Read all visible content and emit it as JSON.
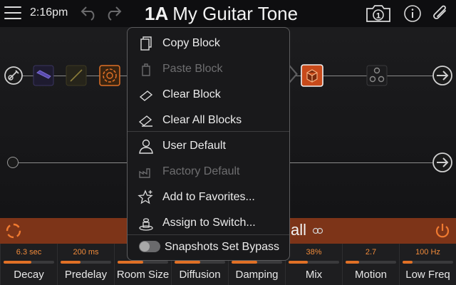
{
  "header": {
    "time": "2:16pm",
    "preset_number": "1A",
    "preset_name": "My Guitar Tone",
    "snapshot_number": "1"
  },
  "signal_flow": {
    "blocks": [
      {
        "name": "input-icon"
      },
      {
        "name": "wah-icon"
      },
      {
        "name": "drive-icon"
      },
      {
        "name": "reverb-icon"
      },
      {
        "name": "amp-cab-icon"
      },
      {
        "name": "split-icon"
      },
      {
        "name": "output-icon"
      }
    ]
  },
  "context_menu": {
    "items": [
      {
        "label": "Copy Block",
        "enabled": true
      },
      {
        "label": "Paste Block",
        "enabled": false
      },
      {
        "label": "Clear Block",
        "enabled": true
      },
      {
        "label": "Clear All Blocks",
        "enabled": true
      },
      {
        "label": "User Default",
        "enabled": true
      },
      {
        "label": "Factory Default",
        "enabled": false
      },
      {
        "label": "Add to Favorites...",
        "enabled": true
      },
      {
        "label": "Assign to Switch...",
        "enabled": true
      }
    ],
    "toggle_label": "Snapshots Set Bypass"
  },
  "block_bar": {
    "model_name_visible": "all"
  },
  "params": [
    {
      "name": "Decay",
      "value": "6.3 sec",
      "level": 0.55
    },
    {
      "name": "Predelay",
      "value": "200 ms",
      "level": 0.4
    },
    {
      "name": "Room Size",
      "value": "",
      "level": 0.5
    },
    {
      "name": "Diffusion",
      "value": "",
      "level": 0.5
    },
    {
      "name": "Damping",
      "value": "",
      "level": 0.5
    },
    {
      "name": "Mix",
      "value": "38%",
      "level": 0.38
    },
    {
      "name": "Motion",
      "value": "2.7",
      "level": 0.27
    },
    {
      "name": "Low Freq",
      "value": "100 Hz",
      "level": 0.2
    }
  ],
  "colors": {
    "accent": "#e07026",
    "bar": "#7d3418"
  }
}
